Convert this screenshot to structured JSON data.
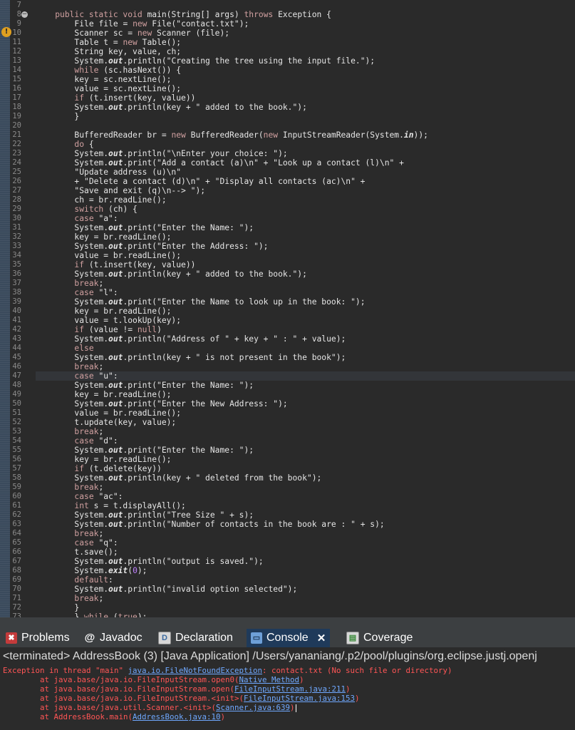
{
  "editor": {
    "lines": [
      {
        "n": "7",
        "segs": []
      },
      {
        "n": "8",
        "segs": [
          [
            "    ",
            ""
          ],
          [
            "public static void",
            "kw"
          ],
          [
            " main(",
            ""
          ],
          [
            "String",
            "cls"
          ],
          [
            "[] args) ",
            ""
          ],
          [
            "throws",
            "kw"
          ],
          [
            " Exception {",
            ""
          ]
        ]
      },
      {
        "n": "9",
        "segs": [
          [
            "        ",
            ""
          ],
          [
            "File",
            "cls"
          ],
          [
            " file = ",
            ""
          ],
          [
            "new",
            "kw"
          ],
          [
            " File(\"contact.txt\");",
            ""
          ]
        ]
      },
      {
        "n": "10",
        "segs": [
          [
            "        ",
            ""
          ],
          [
            "Scanner",
            "cls"
          ],
          [
            " sc = ",
            ""
          ],
          [
            "new",
            "kw"
          ],
          [
            " Scanner (file);",
            ""
          ]
        ]
      },
      {
        "n": "11",
        "segs": [
          [
            "        ",
            ""
          ],
          [
            "Table",
            "cls"
          ],
          [
            " t = ",
            ""
          ],
          [
            "new",
            "kw"
          ],
          [
            " Table();",
            ""
          ]
        ]
      },
      {
        "n": "12",
        "segs": [
          [
            "        ",
            ""
          ],
          [
            "String",
            "cls"
          ],
          [
            " key, value, ch;",
            ""
          ]
        ]
      },
      {
        "n": "13",
        "segs": [
          [
            "        System.",
            ""
          ],
          [
            "out",
            "static"
          ],
          [
            ".println(\"Creating the tree using the input file.\");",
            ""
          ]
        ]
      },
      {
        "n": "14",
        "segs": [
          [
            "        ",
            ""
          ],
          [
            "while",
            "kw"
          ],
          [
            " (sc.hasNext()) {",
            ""
          ]
        ]
      },
      {
        "n": "15",
        "segs": [
          [
            "        key = sc.nextLine();",
            ""
          ]
        ]
      },
      {
        "n": "16",
        "segs": [
          [
            "        value = sc.nextLine();",
            ""
          ]
        ]
      },
      {
        "n": "17",
        "segs": [
          [
            "        ",
            ""
          ],
          [
            "if",
            "kw"
          ],
          [
            " (t.insert(key, value))",
            ""
          ]
        ]
      },
      {
        "n": "18",
        "segs": [
          [
            "        System.",
            ""
          ],
          [
            "out",
            "static"
          ],
          [
            ".println(key + \" added to the book.\");",
            ""
          ]
        ]
      },
      {
        "n": "19",
        "segs": [
          [
            "        }",
            ""
          ]
        ]
      },
      {
        "n": "20",
        "segs": []
      },
      {
        "n": "21",
        "segs": [
          [
            "        BufferedReader br = ",
            ""
          ],
          [
            "new",
            "kw"
          ],
          [
            " BufferedReader(",
            ""
          ],
          [
            "new",
            "kw"
          ],
          [
            " InputStreamReader(System.",
            ""
          ],
          [
            "in",
            "static"
          ],
          [
            "));",
            ""
          ]
        ]
      },
      {
        "n": "22",
        "segs": [
          [
            "        ",
            ""
          ],
          [
            "do",
            "kw"
          ],
          [
            " {",
            ""
          ]
        ]
      },
      {
        "n": "23",
        "segs": [
          [
            "        System.",
            ""
          ],
          [
            "out",
            "static"
          ],
          [
            ".println(\"\\nEnter your choice: \");",
            ""
          ]
        ]
      },
      {
        "n": "24",
        "segs": [
          [
            "        System.",
            ""
          ],
          [
            "out",
            "static"
          ],
          [
            ".print(\"Add a contact (a)\\n\" + \"Look up a contact (l)\\n\" +",
            ""
          ]
        ]
      },
      {
        "n": "25",
        "segs": [
          [
            "        \"Update address (u)\\n\"",
            ""
          ]
        ]
      },
      {
        "n": "26",
        "segs": [
          [
            "        + \"Delete a contact (d)\\n\" + \"Display all contacts (ac)\\n\" +",
            ""
          ]
        ]
      },
      {
        "n": "27",
        "segs": [
          [
            "        \"Save and exit (q)\\n--> \");",
            ""
          ]
        ]
      },
      {
        "n": "28",
        "segs": [
          [
            "        ch = br.readLine();",
            ""
          ]
        ]
      },
      {
        "n": "29",
        "segs": [
          [
            "        ",
            ""
          ],
          [
            "switch",
            "kw"
          ],
          [
            " (ch) {",
            ""
          ]
        ]
      },
      {
        "n": "30",
        "segs": [
          [
            "        ",
            ""
          ],
          [
            "case",
            "kw"
          ],
          [
            " \"a\":",
            ""
          ]
        ]
      },
      {
        "n": "31",
        "segs": [
          [
            "        System.",
            ""
          ],
          [
            "out",
            "static"
          ],
          [
            ".print(\"Enter the Name: \");",
            ""
          ]
        ]
      },
      {
        "n": "32",
        "segs": [
          [
            "        key = br.readLine();",
            ""
          ]
        ]
      },
      {
        "n": "33",
        "segs": [
          [
            "        System.",
            ""
          ],
          [
            "out",
            "static"
          ],
          [
            ".print(\"Enter the Address: \");",
            ""
          ]
        ]
      },
      {
        "n": "34",
        "segs": [
          [
            "        value = br.readLine();",
            ""
          ]
        ]
      },
      {
        "n": "35",
        "segs": [
          [
            "        ",
            ""
          ],
          [
            "if",
            "kw"
          ],
          [
            " (t.insert(key, value))",
            ""
          ]
        ]
      },
      {
        "n": "36",
        "segs": [
          [
            "        System.",
            ""
          ],
          [
            "out",
            "static"
          ],
          [
            ".println(key + \" added to the book.\");",
            ""
          ]
        ]
      },
      {
        "n": "37",
        "segs": [
          [
            "        ",
            ""
          ],
          [
            "break",
            "kw"
          ],
          [
            ";",
            ""
          ]
        ]
      },
      {
        "n": "38",
        "segs": [
          [
            "        ",
            ""
          ],
          [
            "case",
            "kw"
          ],
          [
            " \"l\":",
            ""
          ]
        ]
      },
      {
        "n": "39",
        "segs": [
          [
            "        System.",
            ""
          ],
          [
            "out",
            "static"
          ],
          [
            ".print(\"Enter the Name to look up in the book: \");",
            ""
          ]
        ]
      },
      {
        "n": "40",
        "segs": [
          [
            "        key = br.readLine();",
            ""
          ]
        ]
      },
      {
        "n": "41",
        "segs": [
          [
            "        value = t.lookUp(key);",
            ""
          ]
        ]
      },
      {
        "n": "42",
        "segs": [
          [
            "        ",
            ""
          ],
          [
            "if",
            "kw"
          ],
          [
            " (value != ",
            ""
          ],
          [
            "null",
            "kw"
          ],
          [
            ")",
            ""
          ]
        ]
      },
      {
        "n": "43",
        "segs": [
          [
            "        System.",
            ""
          ],
          [
            "out",
            "static"
          ],
          [
            ".println(\"Address of \" + key + \" : \" + value);",
            ""
          ]
        ]
      },
      {
        "n": "44",
        "segs": [
          [
            "        ",
            ""
          ],
          [
            "else",
            "kw"
          ]
        ]
      },
      {
        "n": "45",
        "segs": [
          [
            "        System.",
            ""
          ],
          [
            "out",
            "static"
          ],
          [
            ".println(key + \" is not present in the book\");",
            ""
          ]
        ]
      },
      {
        "n": "46",
        "segs": [
          [
            "        ",
            ""
          ],
          [
            "break",
            "kw"
          ],
          [
            ";",
            ""
          ]
        ]
      },
      {
        "n": "47",
        "segs": [
          [
            "        ",
            ""
          ],
          [
            "case",
            "kw"
          ],
          [
            " \"u\":",
            ""
          ]
        ],
        "hl": true
      },
      {
        "n": "48",
        "segs": [
          [
            "        System.",
            ""
          ],
          [
            "out",
            "static"
          ],
          [
            ".print(\"Enter the Name: \");",
            ""
          ]
        ]
      },
      {
        "n": "49",
        "segs": [
          [
            "        key = br.readLine();",
            ""
          ]
        ]
      },
      {
        "n": "50",
        "segs": [
          [
            "        System.",
            ""
          ],
          [
            "out",
            "static"
          ],
          [
            ".print(\"Enter the New Address: \");",
            ""
          ]
        ]
      },
      {
        "n": "51",
        "segs": [
          [
            "        value = br.readLine();",
            ""
          ]
        ]
      },
      {
        "n": "52",
        "segs": [
          [
            "        t.update(key, value);",
            ""
          ]
        ]
      },
      {
        "n": "53",
        "segs": [
          [
            "        ",
            ""
          ],
          [
            "break",
            "kw"
          ],
          [
            ";",
            ""
          ]
        ]
      },
      {
        "n": "54",
        "segs": [
          [
            "        ",
            ""
          ],
          [
            "case",
            "kw"
          ],
          [
            " \"d\":",
            ""
          ]
        ]
      },
      {
        "n": "55",
        "segs": [
          [
            "        System.",
            ""
          ],
          [
            "out",
            "static"
          ],
          [
            ".print(\"Enter the Name: \");",
            ""
          ]
        ]
      },
      {
        "n": "56",
        "segs": [
          [
            "        key = br.readLine();",
            ""
          ]
        ]
      },
      {
        "n": "57",
        "segs": [
          [
            "        ",
            ""
          ],
          [
            "if",
            "kw"
          ],
          [
            " (t.delete(key))",
            ""
          ]
        ]
      },
      {
        "n": "58",
        "segs": [
          [
            "        System.",
            ""
          ],
          [
            "out",
            "static"
          ],
          [
            ".println(key + \" deleted from the book\");",
            ""
          ]
        ]
      },
      {
        "n": "59",
        "segs": [
          [
            "        ",
            ""
          ],
          [
            "break",
            "kw"
          ],
          [
            ";",
            ""
          ]
        ]
      },
      {
        "n": "60",
        "segs": [
          [
            "        ",
            ""
          ],
          [
            "case",
            "kw"
          ],
          [
            " \"ac\":",
            ""
          ]
        ]
      },
      {
        "n": "61",
        "segs": [
          [
            "        ",
            ""
          ],
          [
            "int",
            "kw"
          ],
          [
            " s = t.displayAll();",
            ""
          ]
        ]
      },
      {
        "n": "62",
        "segs": [
          [
            "        System.",
            ""
          ],
          [
            "out",
            "static"
          ],
          [
            ".println(\"Tree Size \" + s);",
            ""
          ]
        ]
      },
      {
        "n": "63",
        "segs": [
          [
            "        System.",
            ""
          ],
          [
            "out",
            "static"
          ],
          [
            ".println(\"Number of contacts in the book are : \" + s);",
            ""
          ]
        ]
      },
      {
        "n": "64",
        "segs": [
          [
            "        ",
            ""
          ],
          [
            "break",
            "kw"
          ],
          [
            ";",
            ""
          ]
        ]
      },
      {
        "n": "65",
        "segs": [
          [
            "        ",
            ""
          ],
          [
            "case",
            "kw"
          ],
          [
            " \"q\":",
            ""
          ]
        ]
      },
      {
        "n": "66",
        "segs": [
          [
            "        t.save();",
            ""
          ]
        ]
      },
      {
        "n": "67",
        "segs": [
          [
            "        System.",
            ""
          ],
          [
            "out",
            "static"
          ],
          [
            ".println(\"output is saved.\");",
            ""
          ]
        ]
      },
      {
        "n": "68",
        "segs": [
          [
            "        System.",
            ""
          ],
          [
            "exit",
            "static"
          ],
          [
            "(",
            ""
          ],
          [
            "0",
            "num"
          ],
          [
            ");",
            ""
          ]
        ]
      },
      {
        "n": "69",
        "segs": [
          [
            "        ",
            ""
          ],
          [
            "default",
            "kw"
          ],
          [
            ":",
            ""
          ]
        ]
      },
      {
        "n": "70",
        "segs": [
          [
            "        System.",
            ""
          ],
          [
            "out",
            "static"
          ],
          [
            ".println(\"invalid option selected\");",
            ""
          ]
        ]
      },
      {
        "n": "71",
        "segs": [
          [
            "        ",
            ""
          ],
          [
            "break",
            "kw"
          ],
          [
            ";",
            ""
          ]
        ]
      },
      {
        "n": "72",
        "segs": [
          [
            "        }",
            ""
          ]
        ]
      },
      {
        "n": "73",
        "segs": [
          [
            "        } ",
            ""
          ],
          [
            "while",
            "kw"
          ],
          [
            " (",
            ""
          ],
          [
            "true",
            "kw"
          ],
          [
            ");",
            ""
          ]
        ]
      }
    ]
  },
  "tabs": {
    "problems": {
      "label": "Problems",
      "icon": "problems-icon"
    },
    "javadoc": {
      "label": "Javadoc",
      "icon": "javadoc-icon"
    },
    "declaration": {
      "label": "Declaration",
      "icon": "declaration-icon"
    },
    "console": {
      "label": "Console",
      "icon": "console-icon",
      "close": "✕"
    },
    "coverage": {
      "label": "Coverage",
      "icon": "coverage-icon"
    }
  },
  "status": "<terminated> AddressBook (3) [Java Application] /Users/yananiang/.p2/pool/plugins/org.eclipse.justj.openj",
  "console": {
    "line1_a": "Exception in thread \"main\" ",
    "line1_link": "java.io.FileNotFoundException",
    "line1_b": ": contact.txt (No such file or directory)",
    "line2_a": "\tat java.base/java.io.FileInputStream.open0(",
    "line2_link": "Native Method",
    "line2_b": ")",
    "line3_a": "\tat java.base/java.io.FileInputStream.open(",
    "line3_link": "FileInputStream.java:211",
    "line3_b": ")",
    "line4_a": "\tat java.base/java.io.FileInputStream.<init>(",
    "line4_link": "FileInputStream.java:153",
    "line4_b": ")",
    "line5_a": "\tat java.base/java.util.Scanner.<init>(",
    "line5_link": "Scanner.java:639",
    "line5_b": ")",
    "line6_a": "\tat AddressBook.main(",
    "line6_link": "AddressBook.java:10",
    "line6_b": ")"
  },
  "colors": {
    "keyword": "#d0a0a0",
    "error": "#ff5555",
    "link": "#6fa8ff",
    "tab_active": "#1f3a5a"
  }
}
